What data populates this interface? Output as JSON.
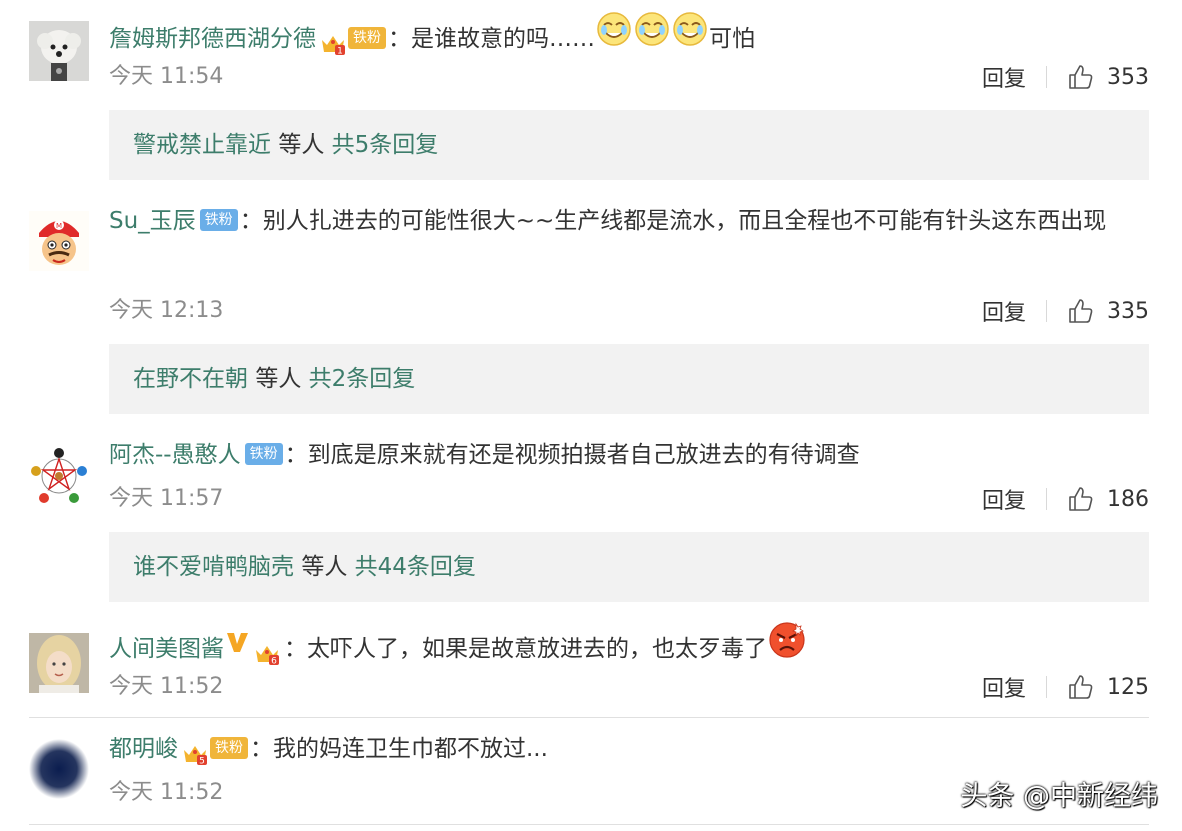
{
  "comments": [
    {
      "username": "詹姆斯邦德西湖分德",
      "badge": "铁粉",
      "badge_level": "1",
      "text_before": "是谁故意的吗……",
      "text_after": "可怕",
      "time": "今天 11:54",
      "reply_label": "回复",
      "likes": "353",
      "replies": {
        "who": "警戒禁止靠近",
        "etc": "等人",
        "count": "共5条回复"
      }
    },
    {
      "username": "Su_玉辰",
      "badge": "铁粉",
      "text": "别人扎进去的可能性很大~~生产线都是流水，而且全程也不可能有针头这东西出现",
      "time": "今天 12:13",
      "reply_label": "回复",
      "likes": "335",
      "replies": {
        "who": "在野不在朝",
        "etc": "等人",
        "count": "共2条回复"
      }
    },
    {
      "username": "阿杰--愚憨人",
      "badge": "铁粉",
      "text": "到底是原来就有还是视频拍摄者自己放进去的有待调查",
      "time": "今天 11:57",
      "reply_label": "回复",
      "likes": "186",
      "replies": {
        "who": "谁不爱啃鸭脑壳",
        "etc": "等人",
        "count": "共44条回复"
      }
    },
    {
      "username": "人间美图酱",
      "badge_level": "6",
      "text": "太吓人了，如果是故意放进去的，也太歹毒了",
      "time": "今天 11:52",
      "reply_label": "回复",
      "likes": "125"
    },
    {
      "username": "都明峻",
      "badge": "铁粉",
      "badge_level": "5",
      "text": "我的妈连卫生巾都不放过...",
      "time": "今天 11:52"
    }
  ],
  "colon": "：",
  "watermark": "头条 @中新经纬",
  "colors": {
    "username": "#3d7d6b",
    "fan_badge": "#6aaee8",
    "gold_badge": "#f0b53a",
    "replies_bg": "#f2f2f2"
  },
  "icons": [
    "like-icon",
    "crown-icon",
    "laugh-cry-emoji",
    "angry-emoji",
    "verified-v-icon"
  ]
}
